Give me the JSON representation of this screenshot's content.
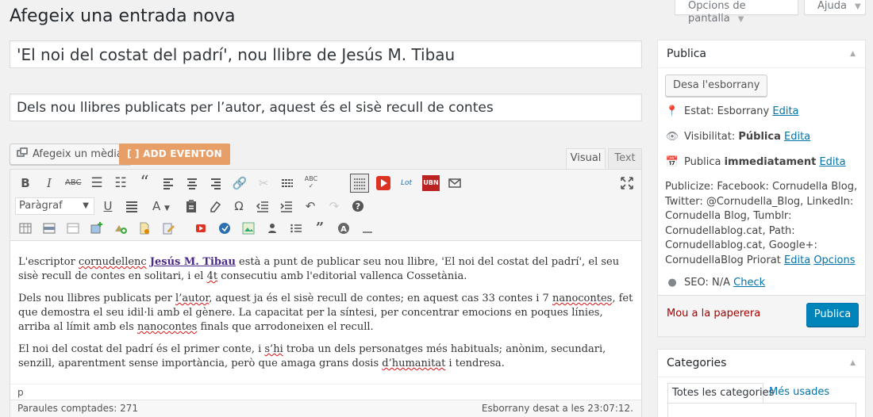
{
  "screen": {
    "options_tab": "Opcions de pantalla",
    "help_tab": "Ajuda",
    "page_title": "Afegeix una entrada nova"
  },
  "post": {
    "title": "'El noi del costat del padrí', nou llibre de Jesús M. Tibau",
    "subtitle": "Dels nou llibres publicats per l’autor, aquest és el sisè recull de contes"
  },
  "editor": {
    "add_media": "Afegeix un mèdia",
    "add_eventon": "[ ] ADD EVENTON",
    "tab_visual": "Visual",
    "tab_text": "Text",
    "format_select": "Paràgraf",
    "paragraphs": {
      "p1_a": "L'escriptor ",
      "p1_b": "cornudellenc",
      "p1_c": " ",
      "p1_link": "Jesús M. Tibau",
      "p1_d": " està a punt de publicar seu nou llibre, 'El noi del costat del padrí', el seu sisè recull de contes en solitari, i el ",
      "p1_e": "4t",
      "p1_f": " consecutiu amb l'editorial vallenca Cossetània.",
      "p2_a": "Dels nou llibres publicats per ",
      "p2_b": "l’autor",
      "p2_c": ", aquest ja és el sisè recull de contes; en aquest cas 33 contes i 7 ",
      "p2_d": "nanocontes",
      "p2_e": ", fet que demostra el seu idil·li amb el gènere. La capacitat per la síntesi, per concentrar emocions en poques línies, arriba al límit amb els ",
      "p2_f": "nanocontes",
      "p2_g": " finals que arrodoneixen el recull.",
      "p3_a": "El noi del costat del padrí és el primer conte, i ",
      "p3_b": "s’hi",
      "p3_c": " troba un dels personatges més habituals; anònim, secundari, senzill, aparentment sense importància, però que amaga grans dosis ",
      "p3_d": "d’humanitat",
      "p3_e": " i tendresa."
    },
    "path": "p",
    "word_count": "Paraules comptades: 271",
    "autosave": "Esborrany desat a les 23:07:12."
  },
  "publish": {
    "header": "Publica",
    "save_draft": "Desa l'esborrany",
    "status_label": "Estat: ",
    "status_value": "Esborrany",
    "visibility_label": "Visibilitat: ",
    "visibility_value": "Pública",
    "schedule_label": "Publica ",
    "schedule_value": "immediatament",
    "edit": "Edita",
    "publicize_text": "Publicize: Facebook: Cornudella Blog, Twitter: @Cornudella_Blog, LinkedIn: Cornudella Blog, Tumblr: Cornudellablog.cat, Path: Cornudellablog.cat, Google+: CornudellaBlog Priorat",
    "publicize_edit": "Edita",
    "publicize_options": "Opcions",
    "seo_label": "SEO: N/A",
    "seo_check": "Check",
    "trash": "Mou a la paperera",
    "publish_button": "Publica"
  },
  "categories": {
    "header": "Categories",
    "tab_all": "Totes les categories",
    "tab_used": "Més usades"
  },
  "icons": {
    "toolbar_row1": [
      "bold-icon",
      "italic-icon",
      "strikethrough-icon",
      "bulleted-list-icon",
      "numbered-list-icon",
      "blockquote-icon",
      "align-left-icon",
      "align-center-icon",
      "align-right-icon",
      "insert-link-icon",
      "unlink-icon",
      "read-more-icon",
      "spellcheck-icon",
      "toolbar-toggle-icon",
      "youtube-icon",
      "lot-plugin-icon",
      "ubn-plugin-icon",
      "email-icon",
      "fullscreen-icon"
    ],
    "toolbar_row2": [
      "underline-icon",
      "justify-icon",
      "text-color-icon",
      "paste-as-text-icon",
      "clear-formatting-icon",
      "special-character-icon",
      "outdent-icon",
      "indent-icon",
      "undo-icon",
      "redo-icon",
      "help-icon"
    ],
    "toolbar_row3": [
      "table-icon",
      "table-row-icon",
      "table-cell-icon",
      "add-image-icon",
      "add-image-plus-icon",
      "add-file-icon",
      "edit-document-icon",
      "youtube-small-icon",
      "shortcode-icon",
      "gallery-icon",
      "user-icon",
      "list-icon",
      "quote-icon",
      "circle-a-icon",
      "horizontal-line-icon"
    ]
  },
  "colors": {
    "publish_button": "#0085ba",
    "eventon_button": "#e89e67",
    "link": "#0073aa",
    "trash": "#aa0000"
  }
}
